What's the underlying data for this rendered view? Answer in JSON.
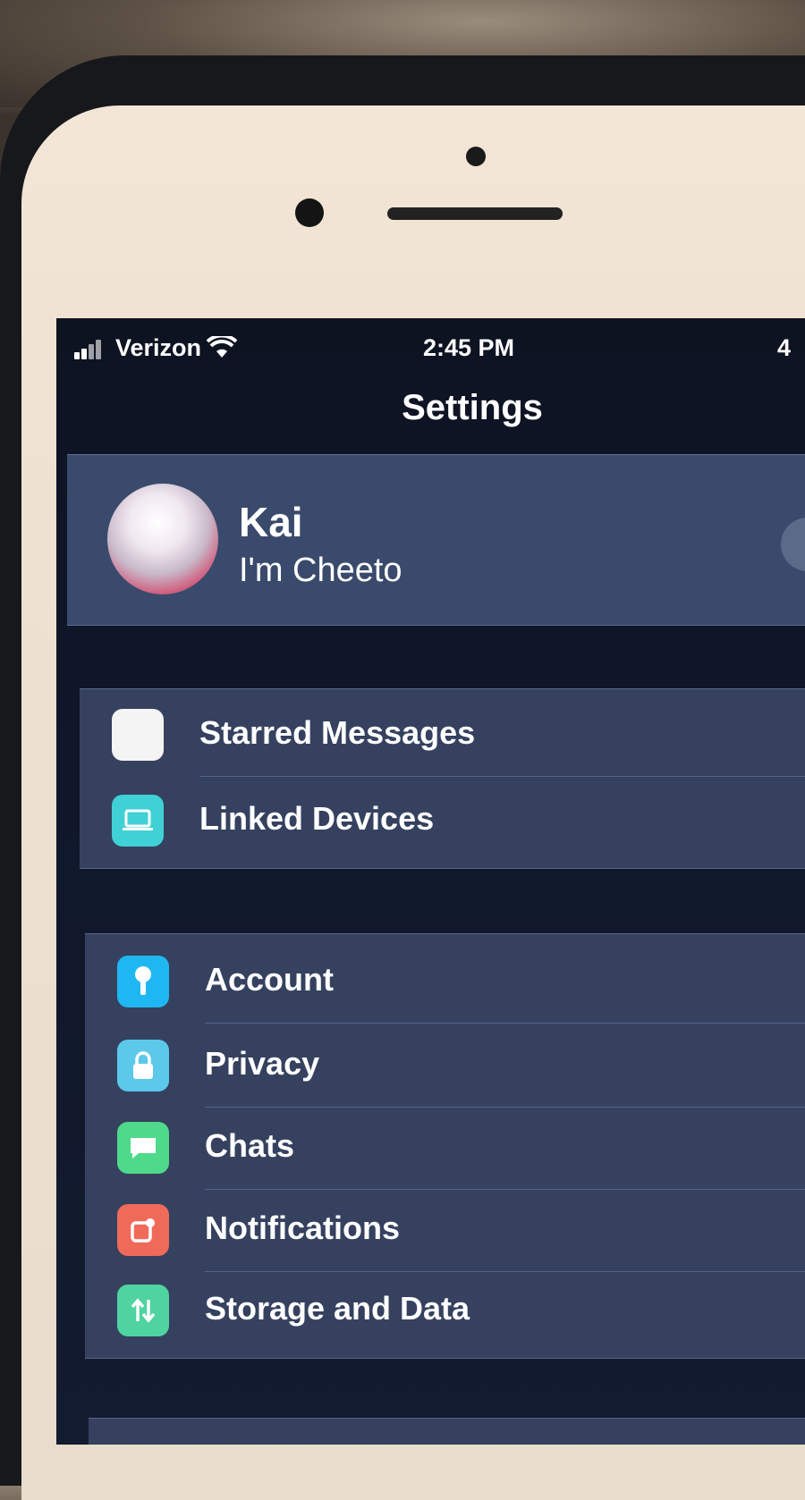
{
  "status_bar": {
    "carrier": "Verizon",
    "time": "2:45 PM",
    "battery_fragment": "4"
  },
  "nav": {
    "title": "Settings"
  },
  "profile": {
    "name": "Kai",
    "status": "I'm Cheeto"
  },
  "group_1": [
    {
      "label": "Starred Messages",
      "icon": "star-icon",
      "color": "#f4f4f4"
    },
    {
      "label": "Linked Devices",
      "icon": "laptop-icon",
      "color": "#3fd1d6"
    }
  ],
  "group_2": [
    {
      "label": "Account",
      "icon": "key-icon",
      "color": "#1fb7f2"
    },
    {
      "label": "Privacy",
      "icon": "lock-icon",
      "color": "#5cc8ea"
    },
    {
      "label": "Chats",
      "icon": "chat-bubble-icon",
      "color": "#4fd98a"
    },
    {
      "label": "Notifications",
      "icon": "notification-icon",
      "color": "#f06a5a"
    },
    {
      "label": "Storage and Data",
      "icon": "arrows-updown-icon",
      "color": "#4fd3a0"
    }
  ]
}
